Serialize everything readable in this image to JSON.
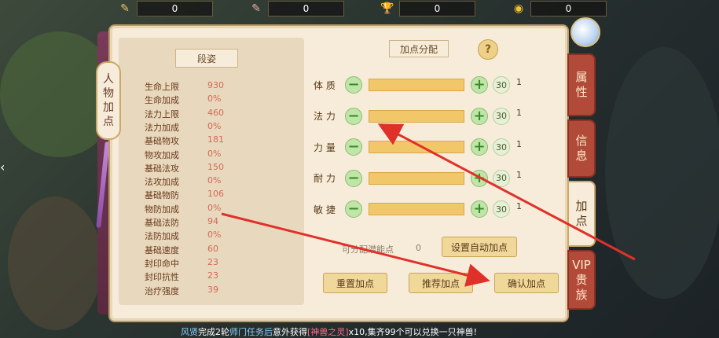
{
  "resources": [
    {
      "icon": "scroll-icon",
      "glyph": "✎",
      "value": "0"
    },
    {
      "icon": "feather-scroll-icon",
      "glyph": "✎",
      "value": "0"
    },
    {
      "icon": "trophy-icon",
      "glyph": "🏆",
      "value": "0"
    },
    {
      "icon": "coin-icon",
      "glyph": "◉",
      "value": "0"
    }
  ],
  "left_tab": {
    "label": "人物加点"
  },
  "stats_panel": {
    "title": "段姿",
    "rows": [
      {
        "name": "生命上限",
        "value": "930"
      },
      {
        "name": "生命加成",
        "value": "0%"
      },
      {
        "name": "法力上限",
        "value": "460"
      },
      {
        "name": "法力加成",
        "value": "0%"
      },
      {
        "name": "基础物攻",
        "value": "181"
      },
      {
        "name": "物攻加成",
        "value": "0%"
      },
      {
        "name": "基础法攻",
        "value": "150"
      },
      {
        "name": "法攻加成",
        "value": "0%"
      },
      {
        "name": "基础物防",
        "value": "106"
      },
      {
        "name": "物防加成",
        "value": "0%"
      },
      {
        "name": "基础法防",
        "value": "94"
      },
      {
        "name": "法防加成",
        "value": "0%"
      },
      {
        "name": "基础速度",
        "value": "60"
      },
      {
        "name": "封印命中",
        "value": "23"
      },
      {
        "name": "封印抗性",
        "value": "23"
      },
      {
        "name": "治疗强度",
        "value": "39"
      }
    ]
  },
  "allocation": {
    "title": "加点分配",
    "help": "?",
    "attributes": [
      {
        "label": "体 质",
        "badge": "30",
        "count": "1"
      },
      {
        "label": "法 力",
        "badge": "30",
        "count": "1"
      },
      {
        "label": "力 量",
        "badge": "30",
        "count": "1"
      },
      {
        "label": "耐 力",
        "badge": "30",
        "count": "1"
      },
      {
        "label": "敏 捷",
        "badge": "30",
        "count": "1"
      }
    ],
    "minus": "−",
    "plus": "+",
    "potential_label": "可分配潜能点",
    "potential_value": "0",
    "auto_button": "设置自动加点",
    "reset_button": "重置加点",
    "recommend_button": "推荐加点",
    "confirm_button": "确认加点"
  },
  "right_tabs": [
    {
      "label": "属性",
      "active": false
    },
    {
      "label": "信息",
      "active": false
    },
    {
      "label": "加点",
      "active": true
    },
    {
      "label": "VIP贵族",
      "active": false
    }
  ],
  "ticker": {
    "name": "风贤",
    "part1": "完成2轮",
    "task": "师门任务后",
    "part2": "意外获得",
    "item": "[神兽之灵]",
    "part3": "x10,集齐99个可以兑换一只神兽!"
  },
  "colors": {
    "annotation_arrow": "#e0302a",
    "accent": "#b24a3a",
    "bar_fill": "#f2c76a"
  }
}
